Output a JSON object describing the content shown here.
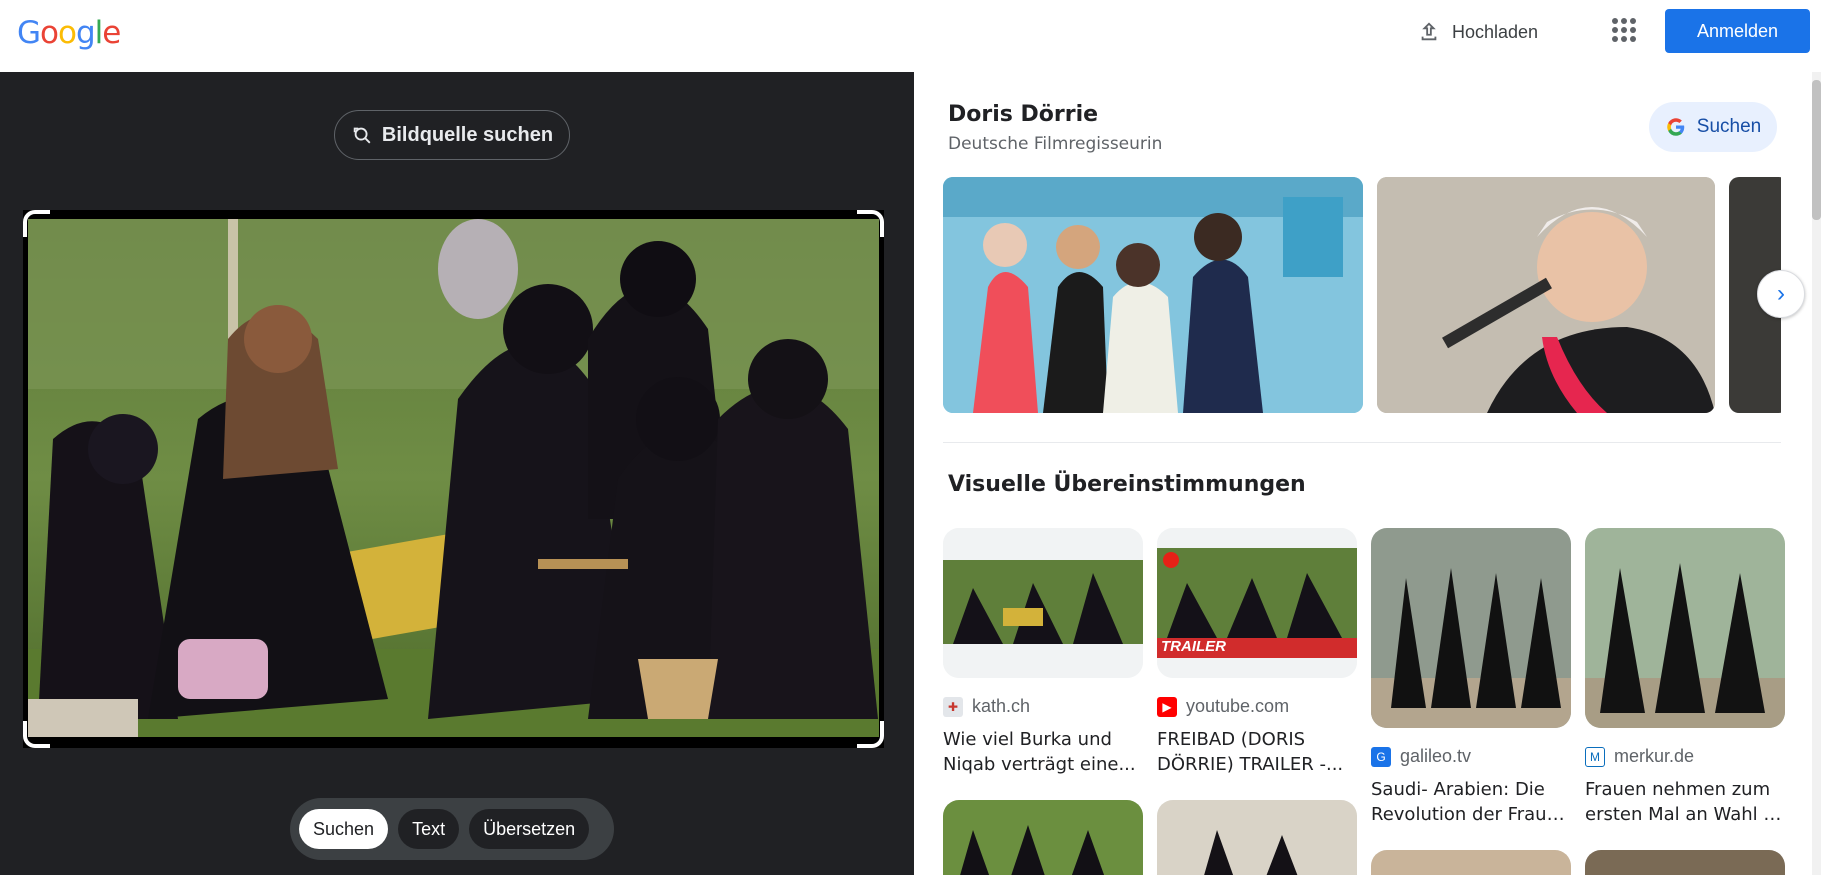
{
  "header": {
    "logo": [
      "G",
      "o",
      "o",
      "g",
      "l",
      "e"
    ],
    "logo_colors": [
      "#4285f4",
      "#ea4335",
      "#fbbc05",
      "#4285f4",
      "#34a853",
      "#ea4335"
    ],
    "upload_label": "Hochladen",
    "apps_icon": "apps-grid-icon",
    "signin_label": "Anmelden"
  },
  "lens": {
    "source_button_label": "Bildquelle suchen",
    "modes": [
      "Suchen",
      "Text",
      "Übersetzen"
    ],
    "active_mode": "Suchen"
  },
  "entity": {
    "name": "Doris Dörrie",
    "description": "Deutsche Filmregisseurin",
    "search_label": "Suchen"
  },
  "visual_matches": {
    "title": "Visuelle Übereinstimmungen",
    "items": [
      {
        "source": "kath.ch",
        "title_line1": "Wie viel Burka und",
        "title_line2": "Niqab verträgt eine..."
      },
      {
        "source": "youtube.com",
        "title_line1": "FREIBAD (DORIS",
        "title_line2": "DÖRRIE) TRAILER -...",
        "overlay": "TRAILER"
      },
      {
        "source": "galileo.tv",
        "title_line1": "Saudi- Arabien: Die",
        "title_line2": "Revolution der Fraue..."
      },
      {
        "source": "merkur.de",
        "title_line1": "Frauen nehmen zum",
        "title_line2": "ersten Mal an Wahl i..."
      }
    ]
  },
  "colors": {
    "accent": "#1a73e8",
    "dark_panel": "#202124"
  }
}
